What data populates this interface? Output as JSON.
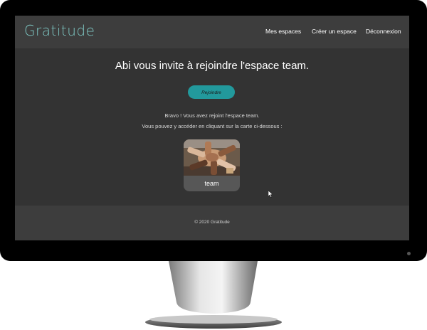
{
  "navbar": {
    "brand": "Gratitude",
    "links": [
      "Mes espaces",
      "Créer un espace",
      "Déconnexion"
    ]
  },
  "main": {
    "heading": "Abi vous invite à rejoindre l'espace team.",
    "join_button": "Rejoindre",
    "message_line1": "Bravo ! Vous avez rejoint l'espace team.",
    "message_line2": "Vous pouvez y accéder en cliquant sur la carte ci-dessous :",
    "card": {
      "label": "team"
    }
  },
  "footer": {
    "copyright": "© 2020 Gratitude"
  },
  "colors": {
    "accent": "#22999c",
    "brand": "#7ec8c4",
    "background": "#333333",
    "bar": "#3d3d3d"
  }
}
